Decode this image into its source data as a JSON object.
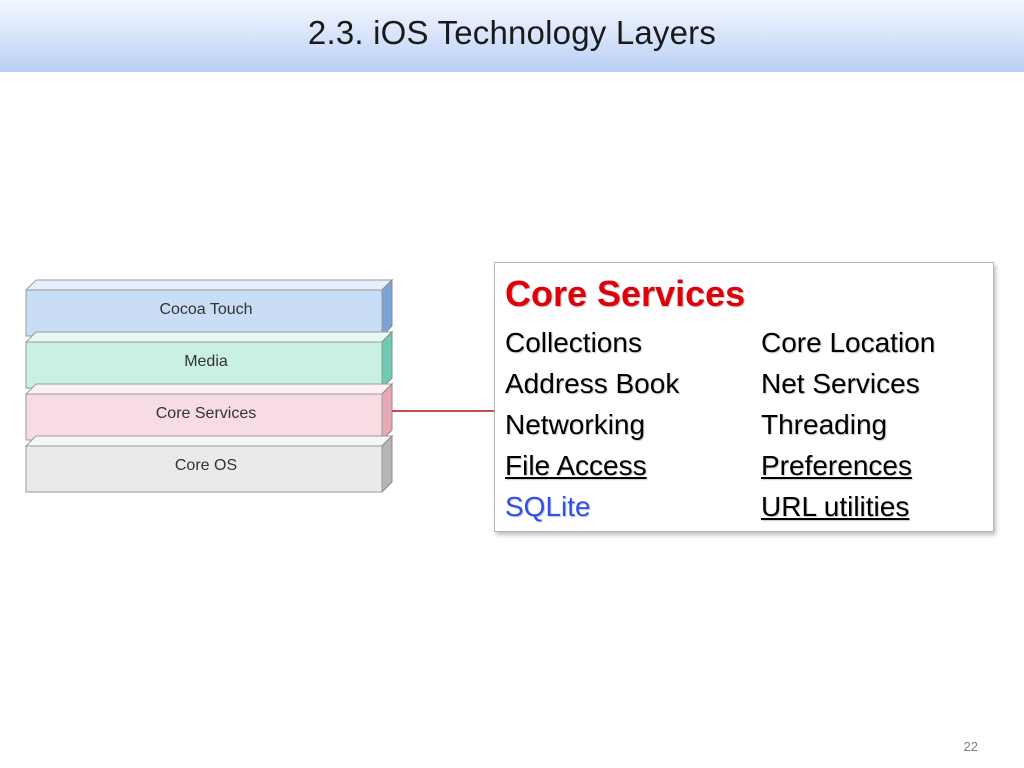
{
  "slide": {
    "title": "2.3. iOS Technology Layers",
    "page_number": "22"
  },
  "layers": [
    {
      "label": "Cocoa Touch",
      "face_color": "#c9ddf6",
      "side_color": "#7aa3d8",
      "top_color": "#e6effb"
    },
    {
      "label": "Media",
      "face_color": "#c8f0e4",
      "side_color": "#6ccbb0",
      "top_color": "#e7f9f3"
    },
    {
      "label": "Core Services",
      "face_color": "#f7dde3",
      "side_color": "#e7a9b6",
      "top_color": "#fcf0f3"
    },
    {
      "label": "Core OS",
      "face_color": "#eaeaea",
      "side_color": "#b5b5b5",
      "top_color": "#f6f6f6"
    }
  ],
  "info_box": {
    "title": "Core Services",
    "title_color": "#e0000b",
    "left_column": [
      {
        "text": "Collections",
        "style": "plain"
      },
      {
        "text": "Address Book",
        "style": "plain"
      },
      {
        "text": "Networking",
        "style": "plain"
      },
      {
        "text": "File Access",
        "style": "underline"
      },
      {
        "text": "SQLite",
        "style": "link"
      }
    ],
    "right_column": [
      {
        "text": "Core Location",
        "style": "plain"
      },
      {
        "text": "Net Services",
        "style": "plain"
      },
      {
        "text": "Threading",
        "style": "plain"
      },
      {
        "text": "Preferences",
        "style": "underline"
      },
      {
        "text": "URL utilities",
        "style": "underline"
      }
    ]
  },
  "colors": {
    "connector": "#c0504d",
    "link": "#2f4ff0"
  }
}
